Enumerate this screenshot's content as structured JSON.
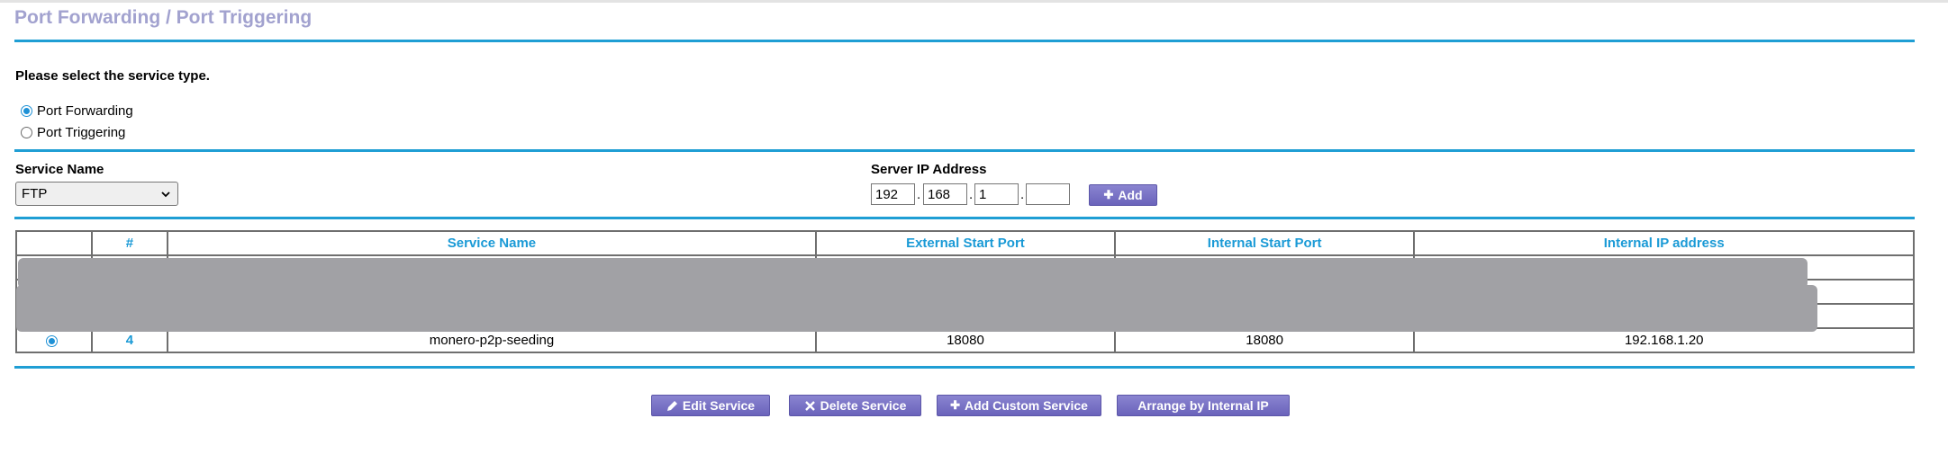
{
  "page_title": "Port Forwarding / Port Triggering",
  "service_type": {
    "prompt": "Please select the service type.",
    "options": [
      {
        "label": "Port Forwarding",
        "checked": true
      },
      {
        "label": "Port Triggering",
        "checked": false
      }
    ]
  },
  "service_name": {
    "label": "Service Name",
    "selected": "FTP"
  },
  "server_ip": {
    "label": "Server IP Address",
    "octets": [
      "192",
      "168",
      "1",
      ""
    ],
    "add_button": "Add"
  },
  "table": {
    "columns": [
      "",
      "#",
      "Service Name",
      "External Start Port",
      "Internal Start Port",
      "Internal IP address"
    ],
    "visible_row": {
      "selected": true,
      "number": "4",
      "service_name": "monero-p2p-seeding",
      "external_start_port": "18080",
      "internal_start_port": "18080",
      "internal_ip": "192.168.1.20"
    }
  },
  "actions": {
    "edit": "Edit Service",
    "delete": "Delete Service",
    "add_custom": "Add Custom Service",
    "arrange": "Arrange by Internal IP"
  },
  "colors": {
    "accent_blue": "#1f9ed4",
    "title_lavender": "#a2a2cf",
    "button_purple": "#6a63bb",
    "redaction_gray": "#a1a1a5"
  },
  "icons": {
    "add": "plus-icon",
    "edit": "pencil-icon",
    "delete": "x-icon",
    "select": "chevron-down-icon"
  }
}
